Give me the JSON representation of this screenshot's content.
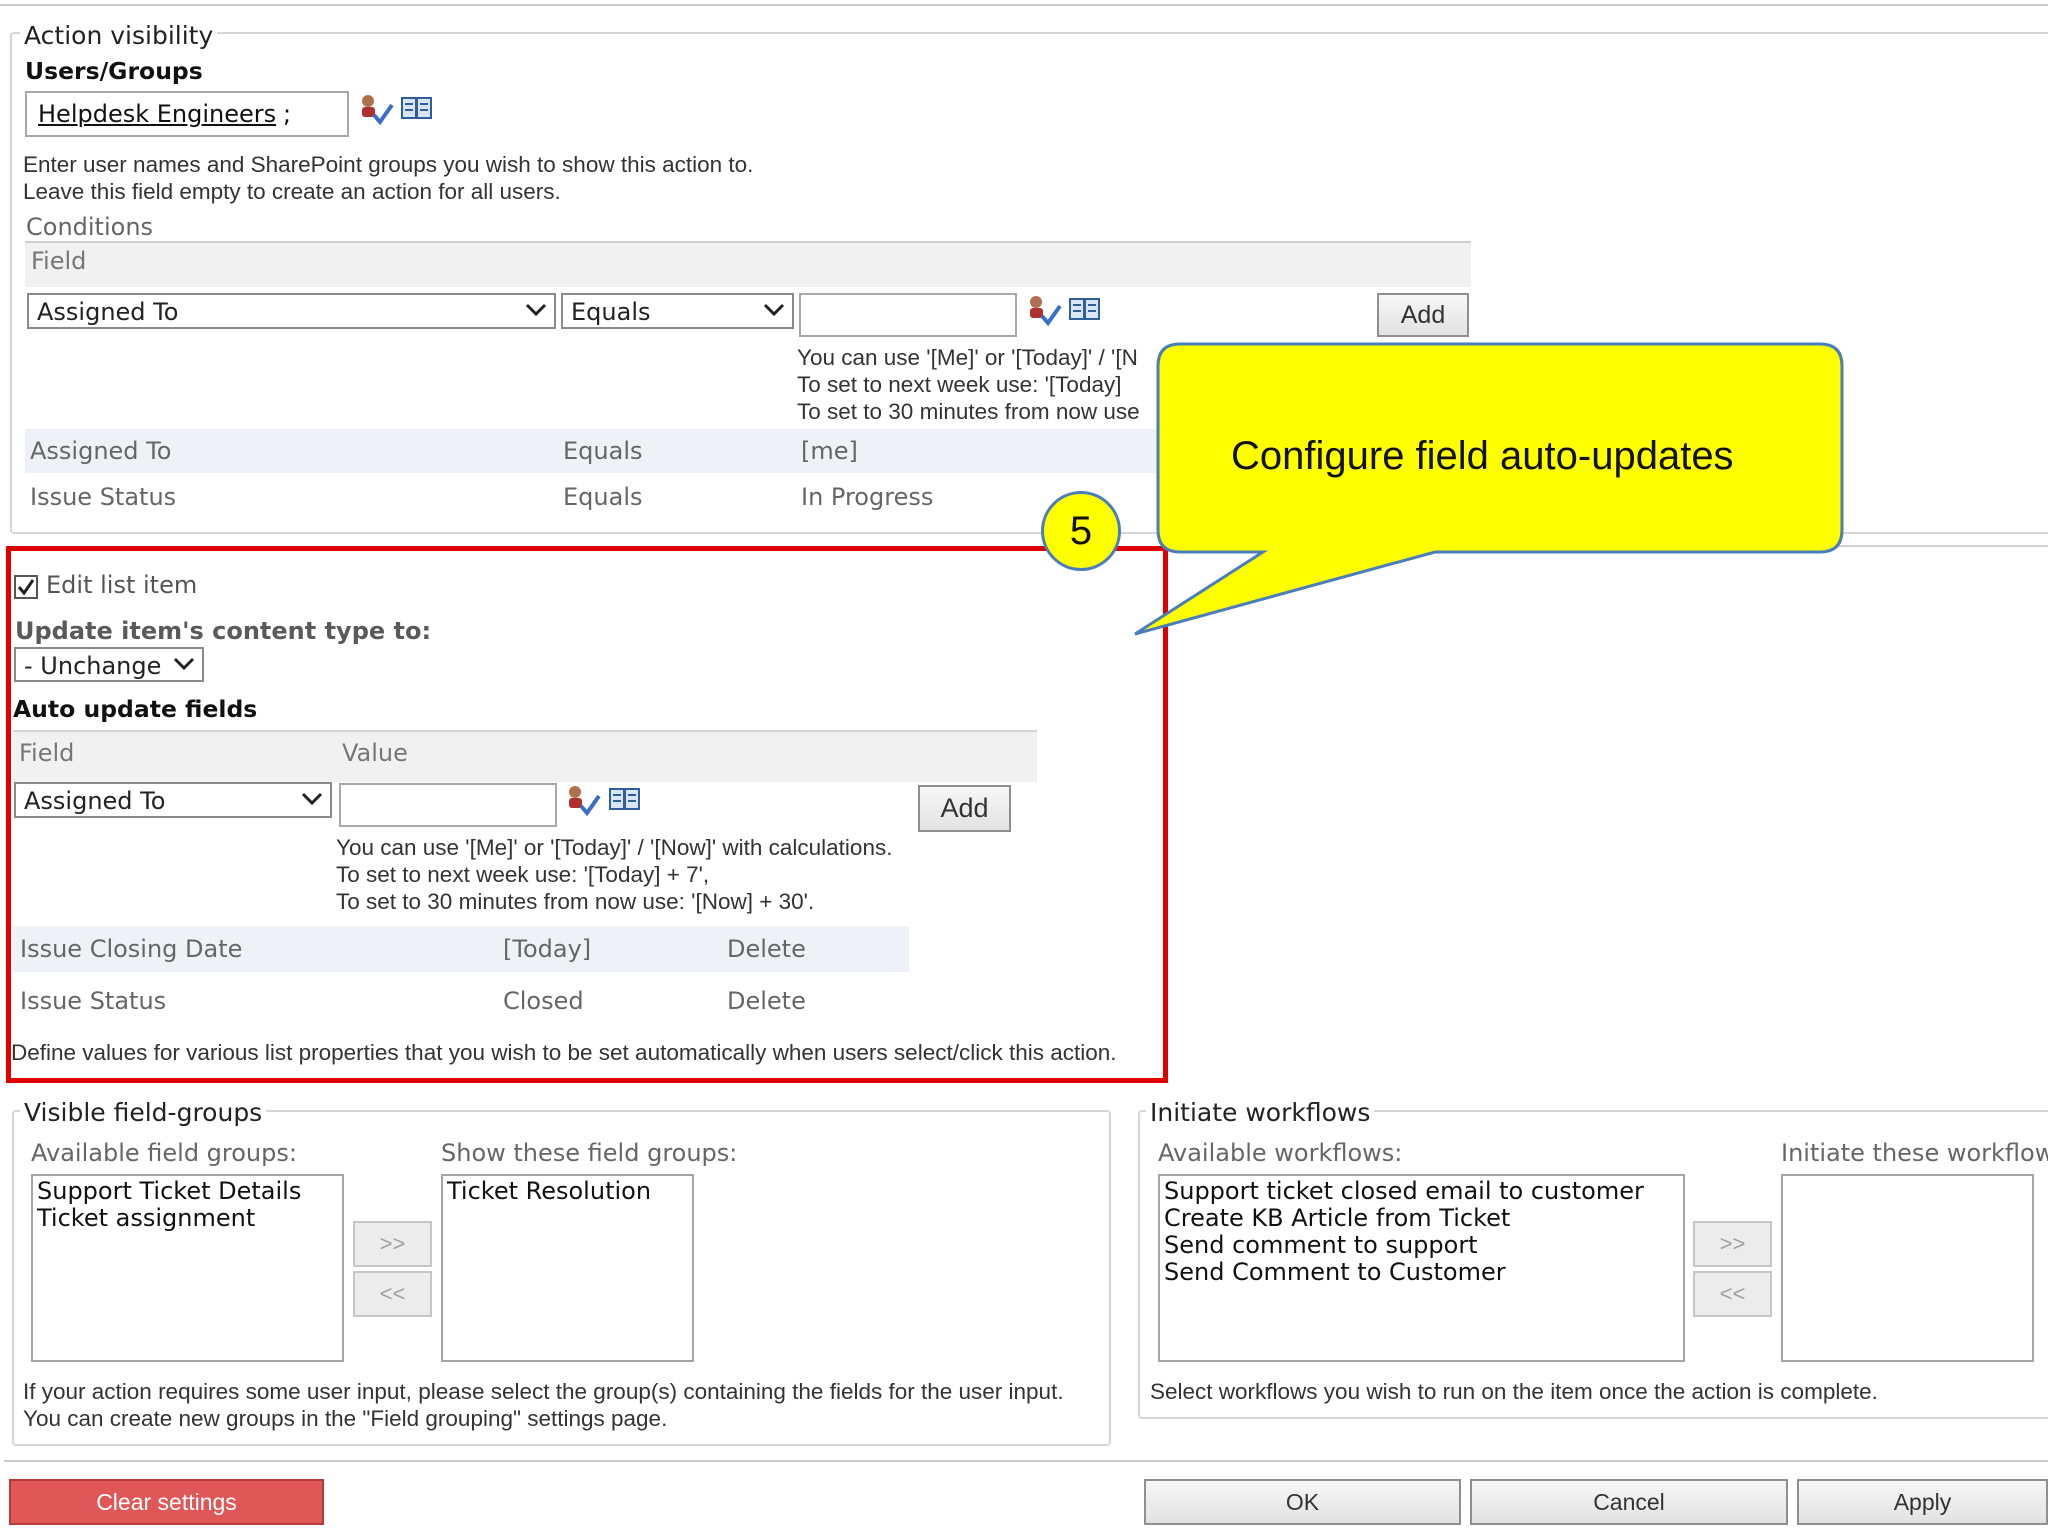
{
  "action_visibility": {
    "legend": "Action visibility",
    "users_groups_label": "Users/Groups",
    "users_value": "Helpdesk Engineers",
    "users_separator": ";",
    "help_line1": "Enter user names and SharePoint groups you wish to show this action to.",
    "help_line2": "Leave this field empty to create an action for all users.",
    "conditions_label": "Conditions",
    "conditions_header_field": "Field",
    "cond_field_select": "Assigned To",
    "cond_operator_select": "Equals",
    "add_label": "Add",
    "cond_hint_line1": "You can use '[Me]' or '[Today]' / '[N",
    "cond_hint_line2": "To set to next week use: '[Today]",
    "cond_hint_line3": "To set to 30 minutes from now use",
    "conditions": [
      {
        "field": "Assigned To",
        "operator": "Equals",
        "value": "[me]"
      },
      {
        "field": "Issue Status",
        "operator": "Equals",
        "value": "In Progress"
      }
    ]
  },
  "callout": {
    "text": "Configure field auto-updates",
    "step_number": "5",
    "fill_color": "#ffff00",
    "border_color": "#4a7ebb"
  },
  "edit_section": {
    "highlight_color": "#e00000",
    "edit_list_item_label": "Edit list item",
    "edit_list_item_checked": true,
    "content_type_label": "Update item's content type to:",
    "content_type_value": "- Unchange",
    "auto_update_label": "Auto update fields",
    "header_field": "Field",
    "header_value": "Value",
    "field_select": "Assigned To",
    "add_label": "Add",
    "hint_line1": "You can use '[Me]' or '[Today]' / '[Now]' with calculations.",
    "hint_line2": "To set to next week use: '[Today] + 7',",
    "hint_line3": "To set to 30 minutes from now use: '[Now] + 30'.",
    "rows": [
      {
        "field": "Issue Closing Date",
        "value": "[Today]",
        "action": "Delete"
      },
      {
        "field": "Issue Status",
        "value": "Closed",
        "action": "Delete"
      }
    ],
    "footer_note": "Define values for various list properties that you wish to be set automatically when users select/click this action."
  },
  "field_groups": {
    "legend": "Visible field-groups",
    "available_label": "Available field groups:",
    "show_label": "Show these field groups:",
    "available_items": [
      "Support Ticket Details",
      "Ticket assignment"
    ],
    "shown_items": [
      "Ticket Resolution"
    ],
    "move_right": ">>",
    "move_left": "<<",
    "note_line1": "If your action requires some user input, please select the group(s) containing the fields for the user input.",
    "note_line2": "You can create new groups in the \"Field grouping\" settings page."
  },
  "workflows": {
    "legend": "Initiate workflows",
    "available_label": "Available workflows:",
    "initiate_label": "Initiate these workflow",
    "available_items": [
      "Support ticket closed email to customer",
      "Create KB Article from Ticket",
      "Send comment to support",
      "Send Comment to Customer"
    ],
    "initiate_items": [],
    "move_right": ">>",
    "move_left": "<<",
    "note": "Select workflows you wish to run on the item once the action is complete."
  },
  "footer_buttons": {
    "clear": "Clear settings",
    "clear_color": "#e05757",
    "ok": "OK",
    "cancel": "Cancel",
    "apply": "Apply"
  },
  "icons": {
    "check_names": "check-names-icon",
    "browse": "address-book-icon"
  }
}
